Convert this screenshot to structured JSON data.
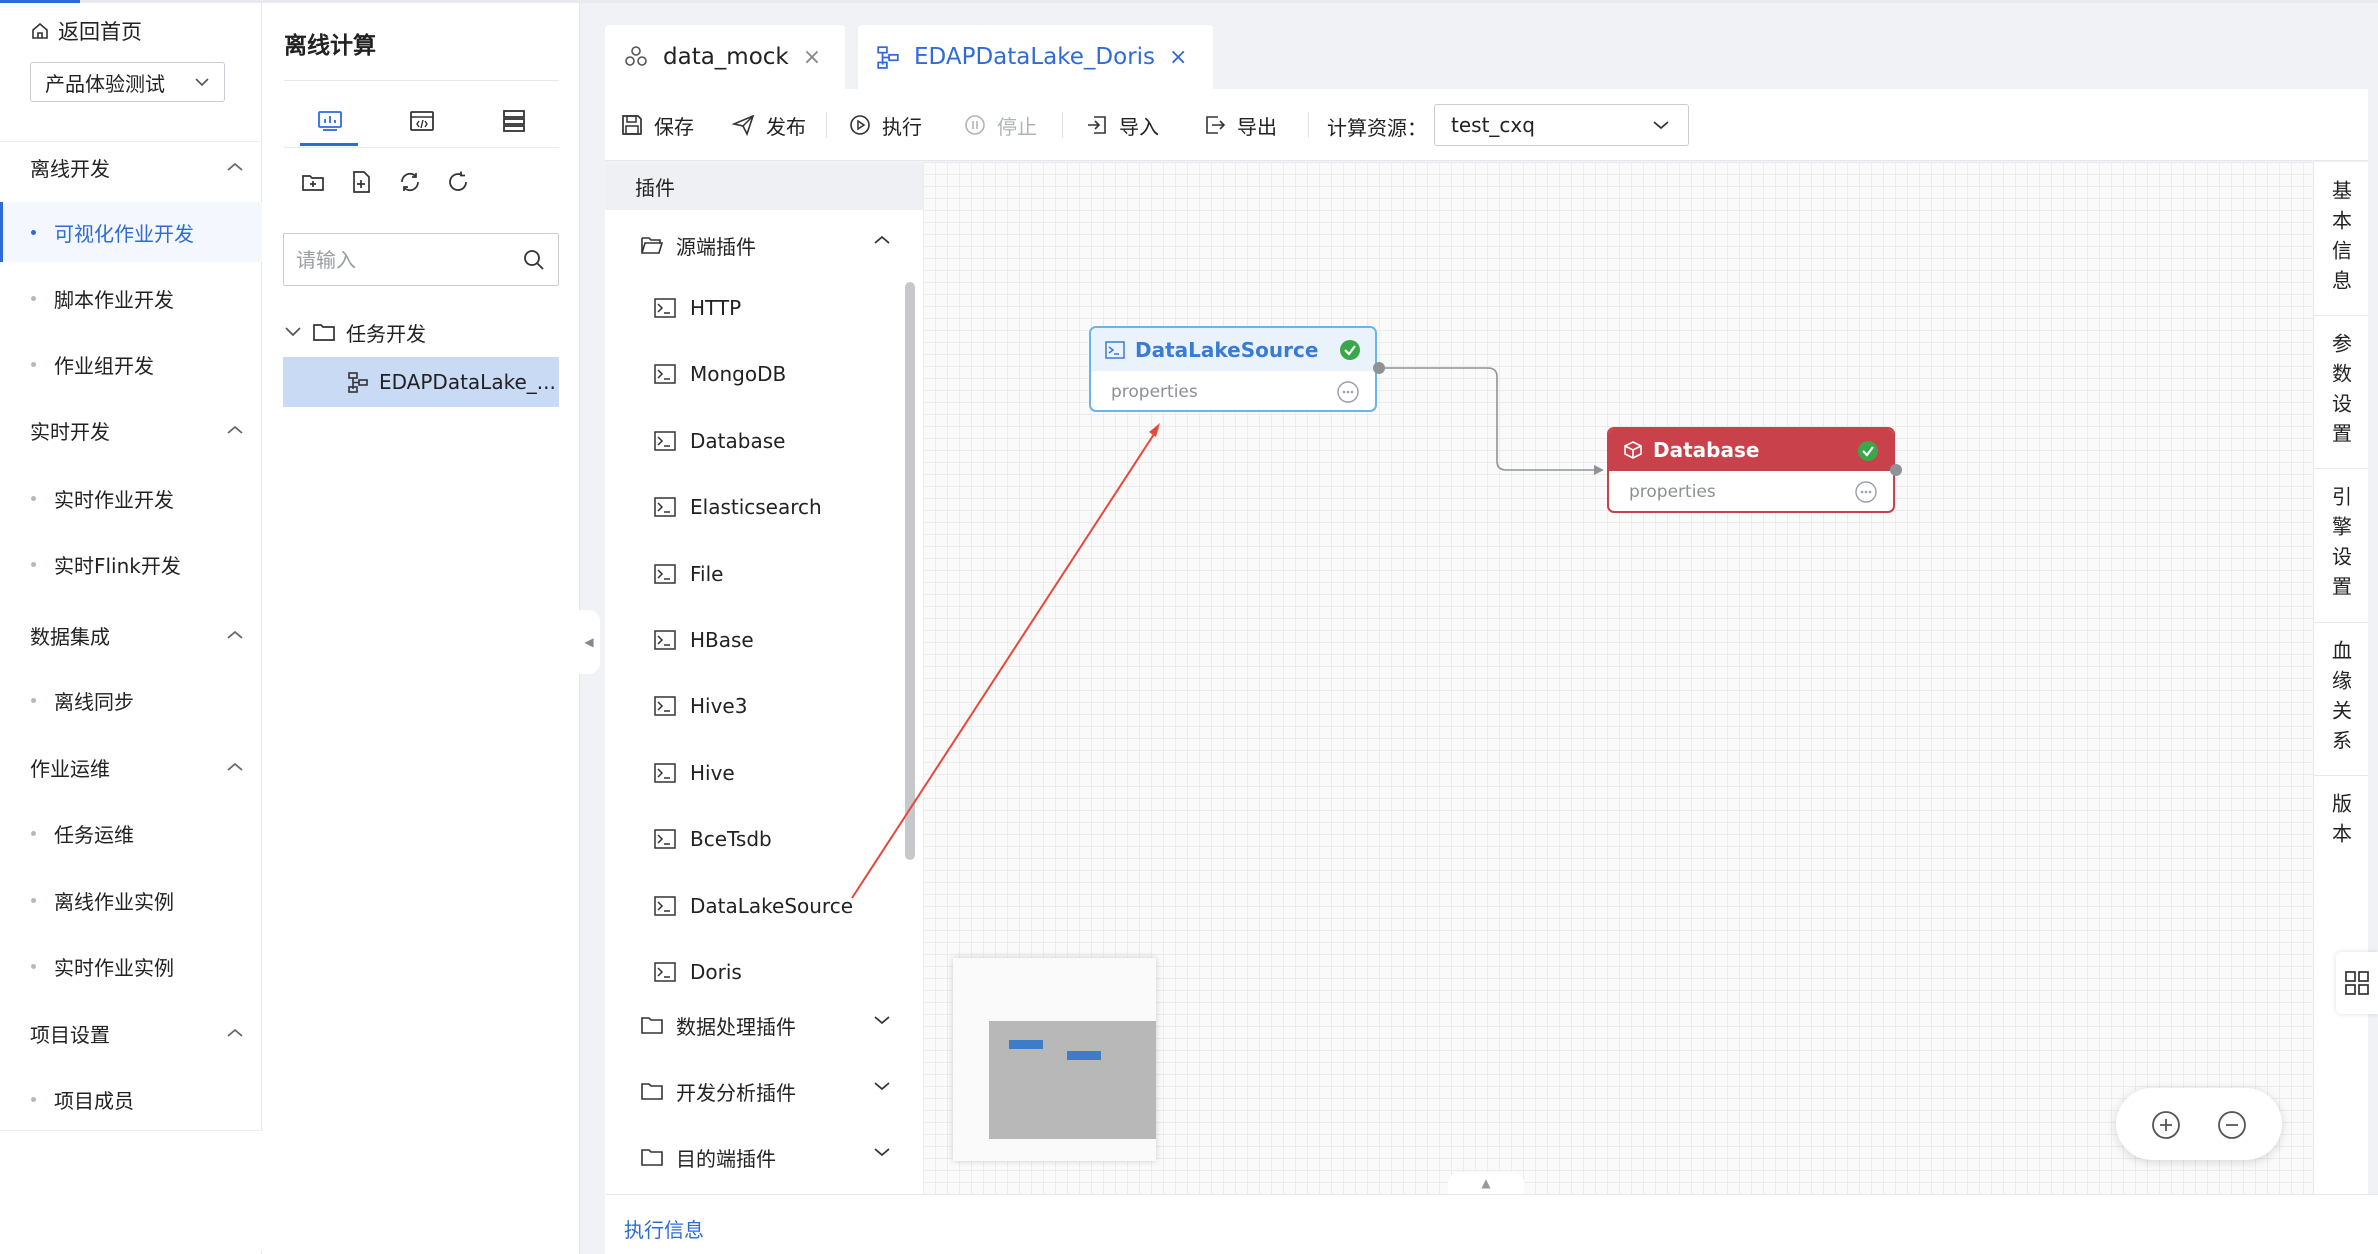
{
  "nav": {
    "back_label": "返回首页",
    "project_value": "产品体验测试",
    "groups": [
      {
        "label": "离线开发",
        "items": [
          "可视化作业开发",
          "脚本作业开发",
          "作业组开发"
        ]
      },
      {
        "label": "实时开发",
        "items": [
          "实时作业开发",
          "实时Flink开发"
        ]
      },
      {
        "label": "数据集成",
        "items": [
          "离线同步"
        ]
      },
      {
        "label": "作业运维",
        "items": [
          "任务运维",
          "离线作业实例",
          "实时作业实例"
        ]
      },
      {
        "label": "项目设置",
        "items": [
          "项目成员"
        ]
      }
    ],
    "active_item": "可视化作业开发"
  },
  "explorer": {
    "title": "离线计算",
    "search_placeholder": "请输入",
    "folder": "任务开发",
    "file": "EDAPDataLake_..."
  },
  "tabs": [
    {
      "label": "data_mock",
      "close": "×"
    },
    {
      "label": "EDAPDataLake_Doris",
      "close": "×"
    }
  ],
  "toolbar": {
    "save": "保存",
    "publish": "发布",
    "run": "执行",
    "stop": "停止",
    "import": "导入",
    "export": "导出",
    "resource_label": "计算资源：",
    "resource_value": "test_cxq"
  },
  "plugins": {
    "header": "插件",
    "source_category": "源端插件",
    "source_items": [
      "HTTP",
      "MongoDB",
      "Database",
      "Elasticsearch",
      "File",
      "HBase",
      "Hive3",
      "Hive",
      "BceTsdb",
      "DataLakeSource",
      "Doris"
    ],
    "other_categories": [
      "数据处理插件",
      "开发分析插件",
      "目的端插件"
    ]
  },
  "canvas": {
    "node_source": {
      "title": "DataLakeSource",
      "body": "properties"
    },
    "node_target": {
      "title": "Database",
      "body": "properties"
    }
  },
  "right_rail": [
    "基本信息",
    "参数设置",
    "引擎设置",
    "血缘关系",
    "版本"
  ],
  "bottom": {
    "exec_info": "执行信息"
  },
  "colors": {
    "accent": "#2f6bd8",
    "source_node": "#69b4ee",
    "target_node": "#c9414a",
    "status_ok": "#3aa84a",
    "annotation_arrow": "#e8483a"
  }
}
